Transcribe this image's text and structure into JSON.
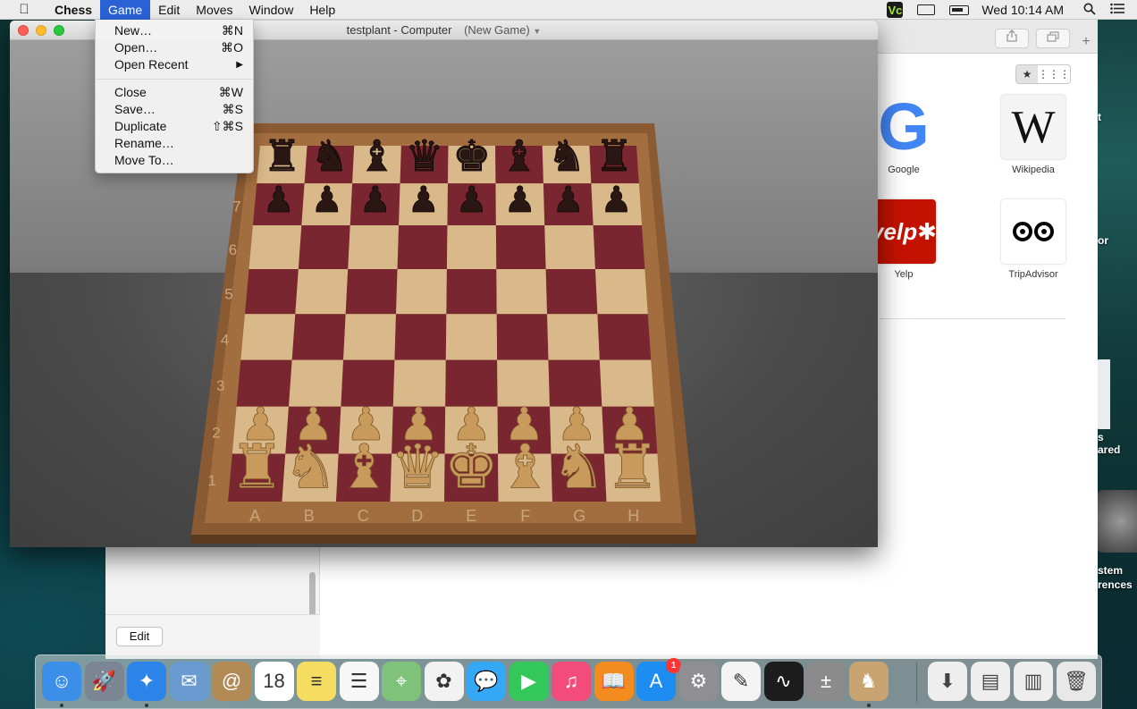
{
  "menubar": {
    "app_name": "Chess",
    "menus": [
      "Game",
      "Edit",
      "Moves",
      "Window",
      "Help"
    ],
    "active_menu": "Game",
    "clock": "Wed 10:14 AM",
    "status_icons": [
      "vnc-icon",
      "display-icon",
      "battery-icon",
      "search-icon",
      "list-icon"
    ]
  },
  "game_menu": {
    "items": [
      {
        "label": "New…",
        "shortcut": "⌘N"
      },
      {
        "label": "Open…",
        "shortcut": "⌘O"
      },
      {
        "label": "Open Recent",
        "shortcut": "▶"
      },
      {
        "label": "Close",
        "shortcut": "⌘W"
      },
      {
        "label": "Save…",
        "shortcut": "⌘S"
      },
      {
        "label": "Duplicate",
        "shortcut": "⇧⌘S"
      },
      {
        "label": "Rename…",
        "shortcut": ""
      },
      {
        "label": "Move To…",
        "shortcut": ""
      }
    ]
  },
  "chess_window": {
    "title": "testplant - Computer",
    "document": "(New Game)",
    "board": {
      "files": [
        "A",
        "B",
        "C",
        "D",
        "E",
        "F",
        "G",
        "H"
      ],
      "ranks": [
        "1",
        "2",
        "3",
        "4",
        "5",
        "6",
        "7"
      ],
      "back_rank": [
        "rook",
        "knight",
        "bishop",
        "queen",
        "king",
        "bishop",
        "knight",
        "rook"
      ],
      "light_square": "#d9b98a",
      "dark_square": "#7a2630",
      "frame": "#8a5a33"
    }
  },
  "safari": {
    "favorites": [
      {
        "label": "Google"
      },
      {
        "label": "Wikipedia"
      },
      {
        "label": "Yelp"
      },
      {
        "label": "TripAdvisor"
      }
    ],
    "edit_label": "Edit"
  },
  "desktop": {
    "labels": [
      "t",
      "or",
      "s",
      "ared",
      "stem",
      "rences"
    ]
  },
  "dock": {
    "apps": [
      {
        "name": "finder-icon",
        "glyph": "☺",
        "color": "#3b8fe8",
        "running": true
      },
      {
        "name": "launchpad-icon",
        "glyph": "🚀",
        "color": "#7b8593",
        "running": false
      },
      {
        "name": "safari-icon",
        "glyph": "✦",
        "color": "#2d84e8",
        "running": true
      },
      {
        "name": "mail-icon",
        "glyph": "✉",
        "color": "#6a9bd0",
        "running": false
      },
      {
        "name": "contacts-icon",
        "glyph": "@",
        "color": "#b28a56",
        "running": false
      },
      {
        "name": "calendar-icon",
        "glyph": "18",
        "color": "#ffffff",
        "running": false
      },
      {
        "name": "notes-icon",
        "glyph": "≡",
        "color": "#f5dd62",
        "running": false
      },
      {
        "name": "reminders-icon",
        "glyph": "☰",
        "color": "#f7f7f7",
        "running": false
      },
      {
        "name": "maps-icon",
        "glyph": "⌖",
        "color": "#7fc37a",
        "running": false
      },
      {
        "name": "photos-icon",
        "glyph": "✿",
        "color": "#f2f2f2",
        "running": false
      },
      {
        "name": "messages-icon",
        "glyph": "💬",
        "color": "#35a8f5",
        "running": false
      },
      {
        "name": "facetime-icon",
        "glyph": "▶",
        "color": "#34c759",
        "running": false
      },
      {
        "name": "itunes-icon",
        "glyph": "♫",
        "color": "#f24c7c",
        "running": false
      },
      {
        "name": "ibooks-icon",
        "glyph": "📖",
        "color": "#f28c1f",
        "running": false
      },
      {
        "name": "app-store-icon",
        "glyph": "A",
        "color": "#1e8df2",
        "running": false,
        "badge": "1"
      },
      {
        "name": "system-preferences-icon",
        "glyph": "⚙",
        "color": "#8e8e93",
        "running": false
      },
      {
        "name": "textedit-icon",
        "glyph": "✎",
        "color": "#f4f4f4",
        "running": false
      },
      {
        "name": "activity-monitor-icon",
        "glyph": "∿",
        "color": "#1c1c1c",
        "running": false
      },
      {
        "name": "calculator-icon",
        "glyph": "±",
        "color": "#8b8b8b",
        "running": false
      },
      {
        "name": "chess-icon",
        "glyph": "♞",
        "color": "#c8a472",
        "running": true
      }
    ],
    "right_items": [
      {
        "name": "downloads-folder-icon",
        "glyph": "⬇",
        "color": "#eeeeee"
      },
      {
        "name": "documents-stack-icon",
        "glyph": "▤",
        "color": "#eeeeee"
      },
      {
        "name": "screenshots-stack-icon",
        "glyph": "▥",
        "color": "#eeeeee"
      },
      {
        "name": "trash-icon",
        "glyph": "🗑",
        "color": "#e8e8e8"
      }
    ]
  }
}
